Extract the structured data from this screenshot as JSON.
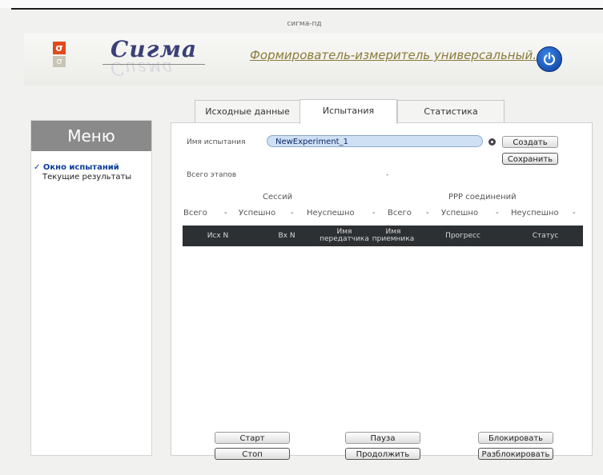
{
  "window": {
    "title": "сигма-пд"
  },
  "header": {
    "brand": "Сигма",
    "logo_top": "σ",
    "logo_bottom": "σ",
    "subtitle": "Формирователь-измеритель универсальный.",
    "power_icon": "power-icon"
  },
  "sidebar": {
    "title": "Меню",
    "items": [
      {
        "label": "Окно испытаний",
        "active": true,
        "check": "✓"
      },
      {
        "label": "Текущие результаты",
        "active": false
      }
    ]
  },
  "tabs": [
    {
      "label": "Исходные данные"
    },
    {
      "label": "Испытания"
    },
    {
      "label": "Статистика"
    }
  ],
  "test": {
    "name_label": "Имя испытания",
    "name_value": "NewExperiment_1",
    "create_label": "Создать",
    "save_label": "Сохранить",
    "stages_label": "Всего этапов",
    "stages_value": "-"
  },
  "stats": {
    "sessions_title": "Сессий",
    "ppp_title": "PPP соединений",
    "cols": [
      "Всего",
      "-",
      "Успешно",
      "-",
      "Неуспешно",
      "-",
      "Всего",
      "-",
      "Успешно",
      "-",
      "Неуспешно",
      "-"
    ]
  },
  "table": {
    "headers": [
      "Исх N",
      "Вх N",
      "Имя передатчика",
      "Имя приемника",
      "Прогресс",
      "Статус"
    ]
  },
  "controls": {
    "start": "Старт",
    "stop": "Стоп",
    "pause": "Пауза",
    "resume": "Продолжить",
    "block": "Блокировать",
    "unblock": "Разблокировать"
  }
}
